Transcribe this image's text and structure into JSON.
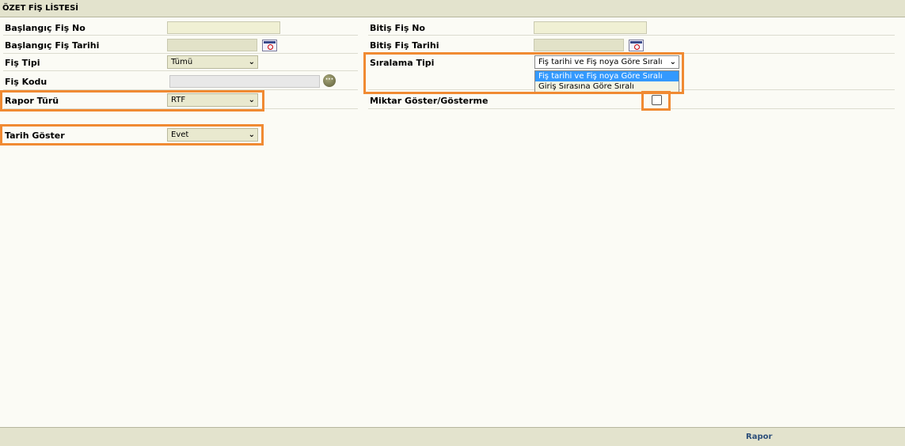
{
  "title": "ÖZET FİŞ LİSTESİ",
  "left": {
    "baslangic_fis_no": {
      "label": "Başlangıç Fiş No",
      "value": ""
    },
    "baslangic_fis_tarihi": {
      "label": "Başlangıç Fiş Tarihi",
      "value": ""
    },
    "fis_tipi": {
      "label": "Fiş Tipi",
      "value": "Tümü"
    },
    "fis_kodu": {
      "label": "Fiş Kodu",
      "value": ""
    },
    "rapor_turu": {
      "label": "Rapor Türü",
      "value": "RTF"
    },
    "tarih_goster": {
      "label": "Tarih Göster",
      "value": "Evet"
    }
  },
  "right": {
    "bitis_fis_no": {
      "label": "Bitiş Fiş No",
      "value": ""
    },
    "bitis_fis_tarihi": {
      "label": "Bitiş Fiş Tarihi",
      "value": ""
    },
    "siralama_tipi": {
      "label": "Sıralama Tipi",
      "value": "Fiş tarihi ve Fiş noya Göre Sıralı",
      "options": [
        "Fiş tarihi ve Fiş noya Göre Sıralı",
        "Giriş Sırasına Göre Sıralı"
      ],
      "selected_index": 0
    },
    "miktar_goster": {
      "label": "Miktar Göster/Gösterme",
      "checked": false
    }
  },
  "icons": {
    "calendar": "calendar-icon",
    "lookup": "ellipsis-icon",
    "chevron": "chevron-down-icon"
  },
  "colors": {
    "highlight": "#f08a32",
    "header": "#e3e3cd",
    "selected_option": "#3399ff"
  },
  "footer": {
    "rapor_label": "Rapor"
  }
}
